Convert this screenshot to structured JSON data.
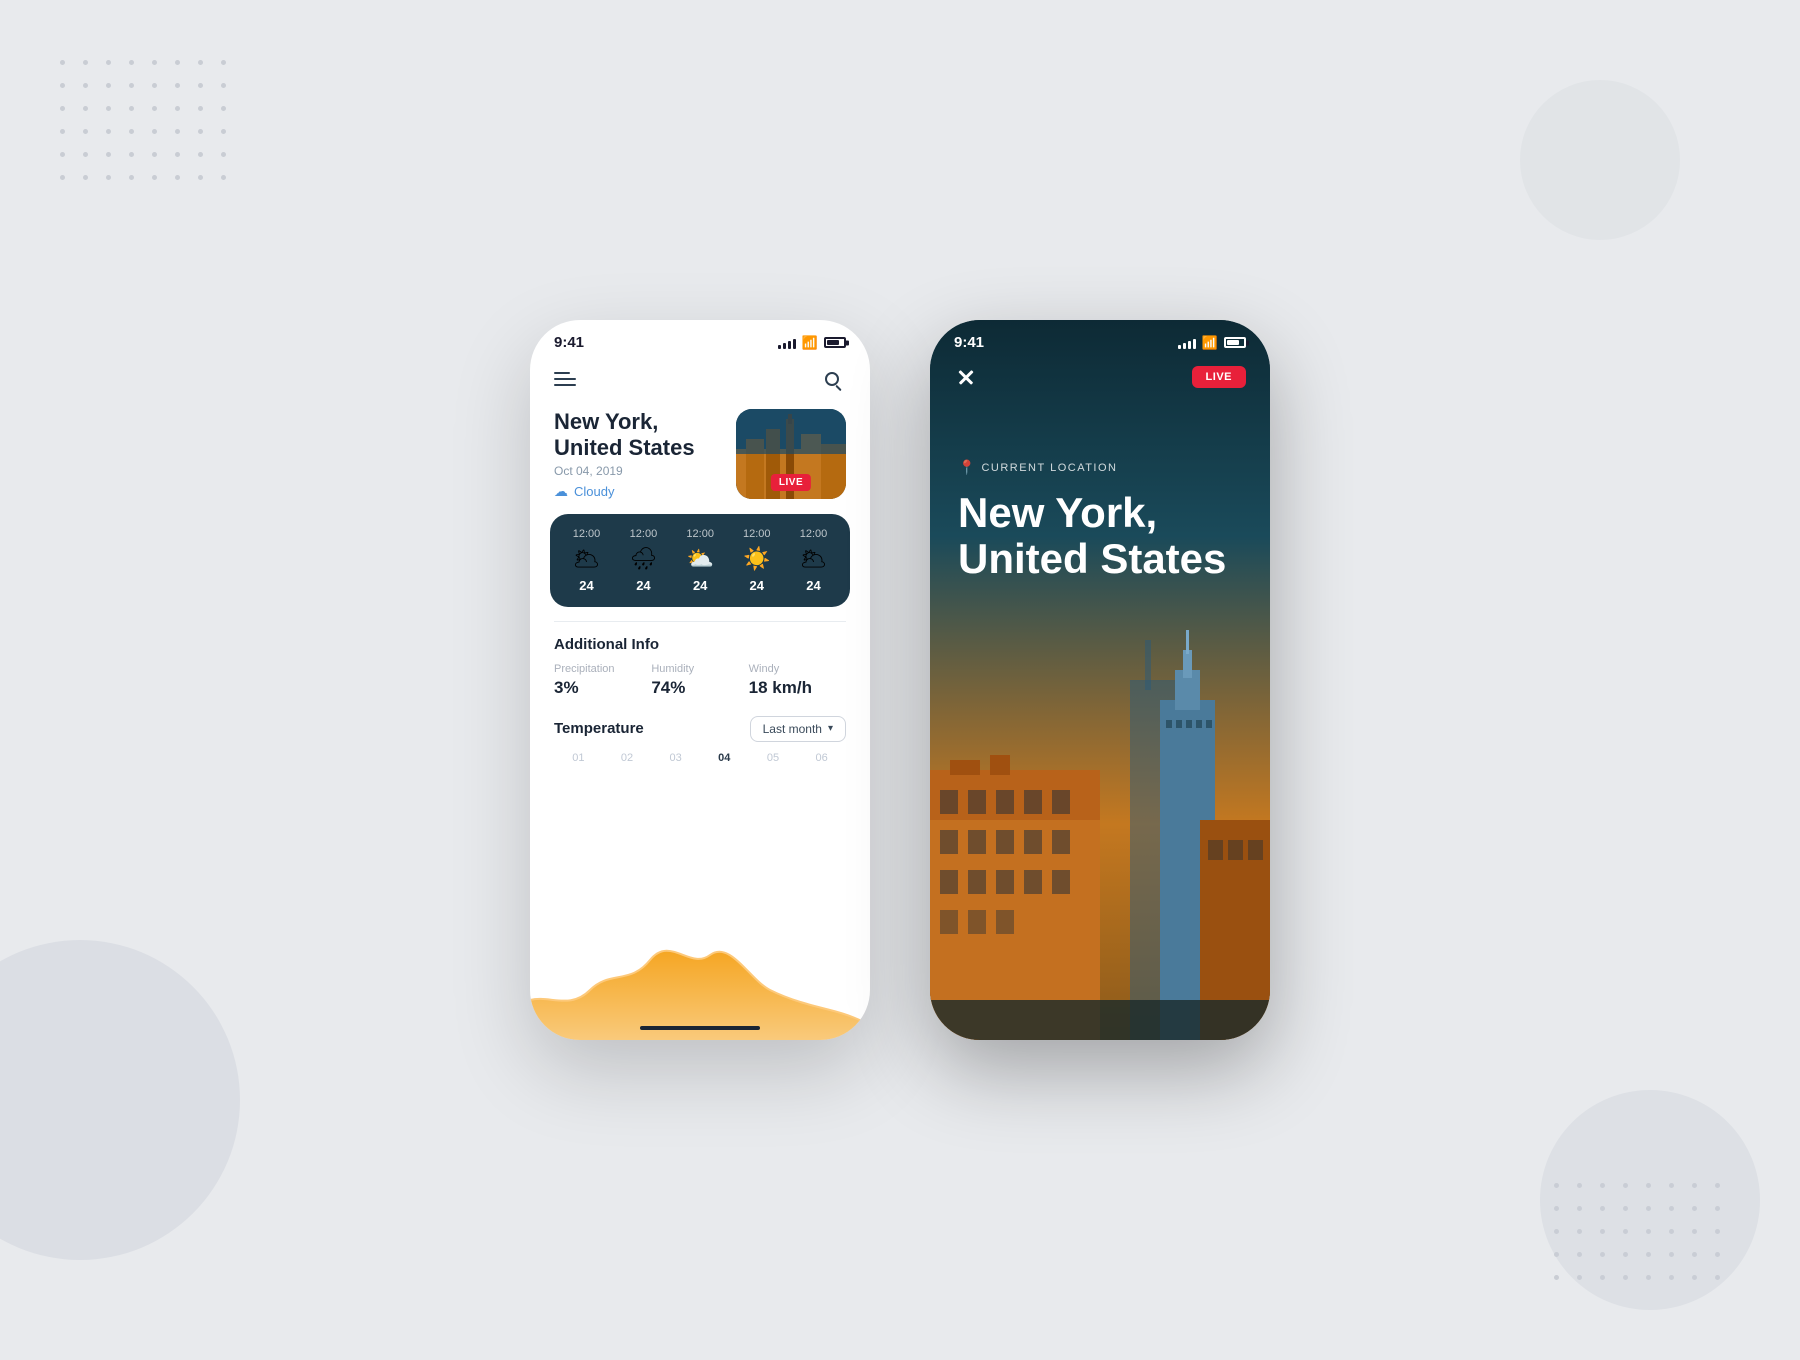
{
  "background": {
    "color": "#e4e7ed"
  },
  "phone_light": {
    "status_bar": {
      "time": "9:41",
      "signal": "signal",
      "wifi": "wifi",
      "battery": "battery"
    },
    "nav": {
      "menu_label": "menu",
      "search_label": "search"
    },
    "location": {
      "city": "New York,",
      "country": "United States",
      "date": "Oct 04, 2019",
      "condition": "Cloudy"
    },
    "live_badge": "LIVE",
    "forecast": [
      {
        "time": "12:00",
        "icon": "🌥",
        "temp": "24"
      },
      {
        "time": "12:00",
        "icon": "🌧",
        "temp": "24"
      },
      {
        "time": "12:00",
        "icon": "⛅",
        "temp": "24"
      },
      {
        "time": "12:00",
        "icon": "☀",
        "temp": "24"
      },
      {
        "time": "12:00",
        "icon": "🌥",
        "temp": "24"
      }
    ],
    "additional_info": {
      "title": "Additional Info",
      "precipitation_label": "Precipitation",
      "precipitation_value": "3%",
      "humidity_label": "Humidity",
      "humidity_value": "74%",
      "windy_label": "Windy",
      "windy_value": "18 km/h"
    },
    "temperature": {
      "title": "Temperature",
      "dropdown_label": "Last month",
      "chart_labels": [
        "01",
        "02",
        "03",
        "04",
        "05",
        "06"
      ]
    }
  },
  "phone_dark": {
    "status_bar": {
      "time": "9:41"
    },
    "live_badge": "LIVE",
    "current_location_label": "CURRENT LOCATION",
    "city": "New York,",
    "country": "United States"
  }
}
